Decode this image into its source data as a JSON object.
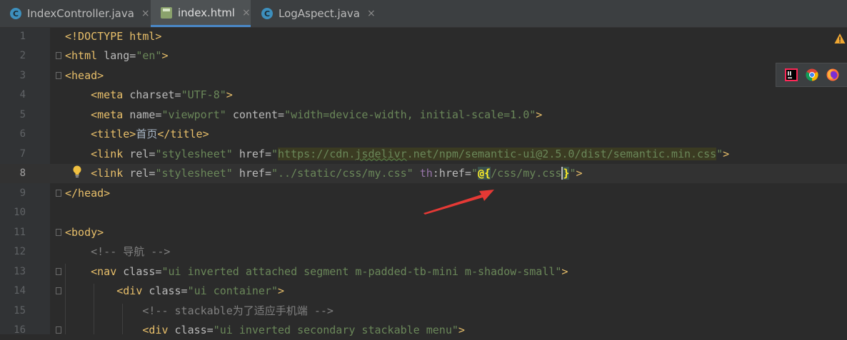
{
  "tabs": [
    {
      "label": "IndexController.java",
      "icon": "class-c-icon",
      "active": false
    },
    {
      "label": "index.html",
      "icon": "html-file-icon",
      "active": true
    },
    {
      "label": "LogAspect.java",
      "icon": "class-c-icon",
      "active": false
    }
  ],
  "tab_close_glyph": "×",
  "tab_class_glyph": "C",
  "browser_icons": [
    "intellij-icon",
    "chrome-icon",
    "firefox-icon"
  ],
  "colors": {
    "background": "#2b2b2b",
    "tag": "#e8bf6a",
    "attr_value": "#6a8759",
    "comment": "#808080",
    "active_tab_underline": "#4a88c7",
    "annotation_arrow": "#e53935"
  },
  "current_line": 8,
  "lines": [
    {
      "n": "1",
      "segs": [
        [
          "tg",
          "<!DOCTYPE html>"
        ]
      ]
    },
    {
      "n": "2",
      "segs": [
        [
          "tg",
          "<html "
        ],
        [
          "at",
          "lang="
        ],
        [
          "av",
          "\"en\""
        ],
        [
          "tg",
          ">"
        ]
      ]
    },
    {
      "n": "3",
      "segs": [
        [
          "tg",
          "<head>"
        ]
      ]
    },
    {
      "n": "4",
      "segs": [
        [
          "tx",
          "    "
        ],
        [
          "tg",
          "<meta "
        ],
        [
          "at",
          "charset="
        ],
        [
          "av",
          "\"UTF-8\""
        ],
        [
          "tg",
          ">"
        ]
      ]
    },
    {
      "n": "5",
      "segs": [
        [
          "tx",
          "    "
        ],
        [
          "tg",
          "<meta "
        ],
        [
          "at",
          "name="
        ],
        [
          "av",
          "\"viewport\" "
        ],
        [
          "at",
          "content="
        ],
        [
          "av",
          "\"width=device-width, initial-scale=1.0\""
        ],
        [
          "tg",
          ">"
        ]
      ]
    },
    {
      "n": "6",
      "segs": [
        [
          "tx",
          "    "
        ],
        [
          "tg",
          "<title>"
        ],
        [
          "tx",
          "首页"
        ],
        [
          "tg",
          "</title>"
        ]
      ]
    },
    {
      "n": "7",
      "segs": [
        [
          "tx",
          "    "
        ],
        [
          "tg",
          "<link "
        ],
        [
          "at",
          "rel="
        ],
        [
          "av",
          "\"stylesheet\" "
        ],
        [
          "at",
          "href="
        ],
        [
          "av",
          "\""
        ],
        [
          "avurl",
          "https://cdn."
        ],
        [
          "avurlu",
          "jsdelivr"
        ],
        [
          "avurl",
          ".net/npm/semantic-ui@2.5.0/dist/semantic.min.css"
        ],
        [
          "av",
          "\""
        ],
        [
          "tg",
          ">"
        ]
      ]
    },
    {
      "n": "8",
      "segs": [
        [
          "tx",
          "    "
        ],
        [
          "tg",
          "<link "
        ],
        [
          "at",
          "rel="
        ],
        [
          "av",
          "\"stylesheet\" "
        ],
        [
          "at",
          "href="
        ],
        [
          "av",
          "\"../static/css/my.css\" "
        ],
        [
          "ns",
          "th"
        ],
        [
          "at",
          ":href="
        ],
        [
          "av",
          "\""
        ],
        [
          "hb",
          "@{"
        ],
        [
          "av",
          "/css/my.css"
        ],
        [
          "cb",
          "}"
        ],
        [
          "av",
          "\""
        ],
        [
          "tg",
          ">"
        ]
      ]
    },
    {
      "n": "9",
      "segs": [
        [
          "tg",
          "</head>"
        ]
      ]
    },
    {
      "n": "10",
      "segs": []
    },
    {
      "n": "11",
      "segs": [
        [
          "tg",
          "<body>"
        ]
      ]
    },
    {
      "n": "12",
      "segs": [
        [
          "tx",
          "    "
        ],
        [
          "cm",
          "<!-- 导航 -->"
        ]
      ]
    },
    {
      "n": "13",
      "segs": [
        [
          "tx",
          "    "
        ],
        [
          "tg",
          "<nav "
        ],
        [
          "at",
          "class="
        ],
        [
          "av",
          "\"ui inverted attached segment m-padded-tb-mini m-shadow-small\""
        ],
        [
          "tg",
          ">"
        ]
      ]
    },
    {
      "n": "14",
      "segs": [
        [
          "tx",
          "        "
        ],
        [
          "tg",
          "<div "
        ],
        [
          "at",
          "class="
        ],
        [
          "av",
          "\"ui container\""
        ],
        [
          "tg",
          ">"
        ]
      ]
    },
    {
      "n": "15",
      "segs": [
        [
          "tx",
          "            "
        ],
        [
          "cm",
          "<!-- stackable为了适应手机端 -->"
        ]
      ]
    },
    {
      "n": "16",
      "segs": [
        [
          "tx",
          "            "
        ],
        [
          "tg",
          "<div "
        ],
        [
          "at",
          "class="
        ],
        [
          "av",
          "\"ui inverted secondary stackable menu\""
        ],
        [
          "tg",
          ">"
        ]
      ]
    }
  ],
  "fold_lines": [
    2,
    3,
    9,
    11,
    13,
    14,
    16
  ]
}
